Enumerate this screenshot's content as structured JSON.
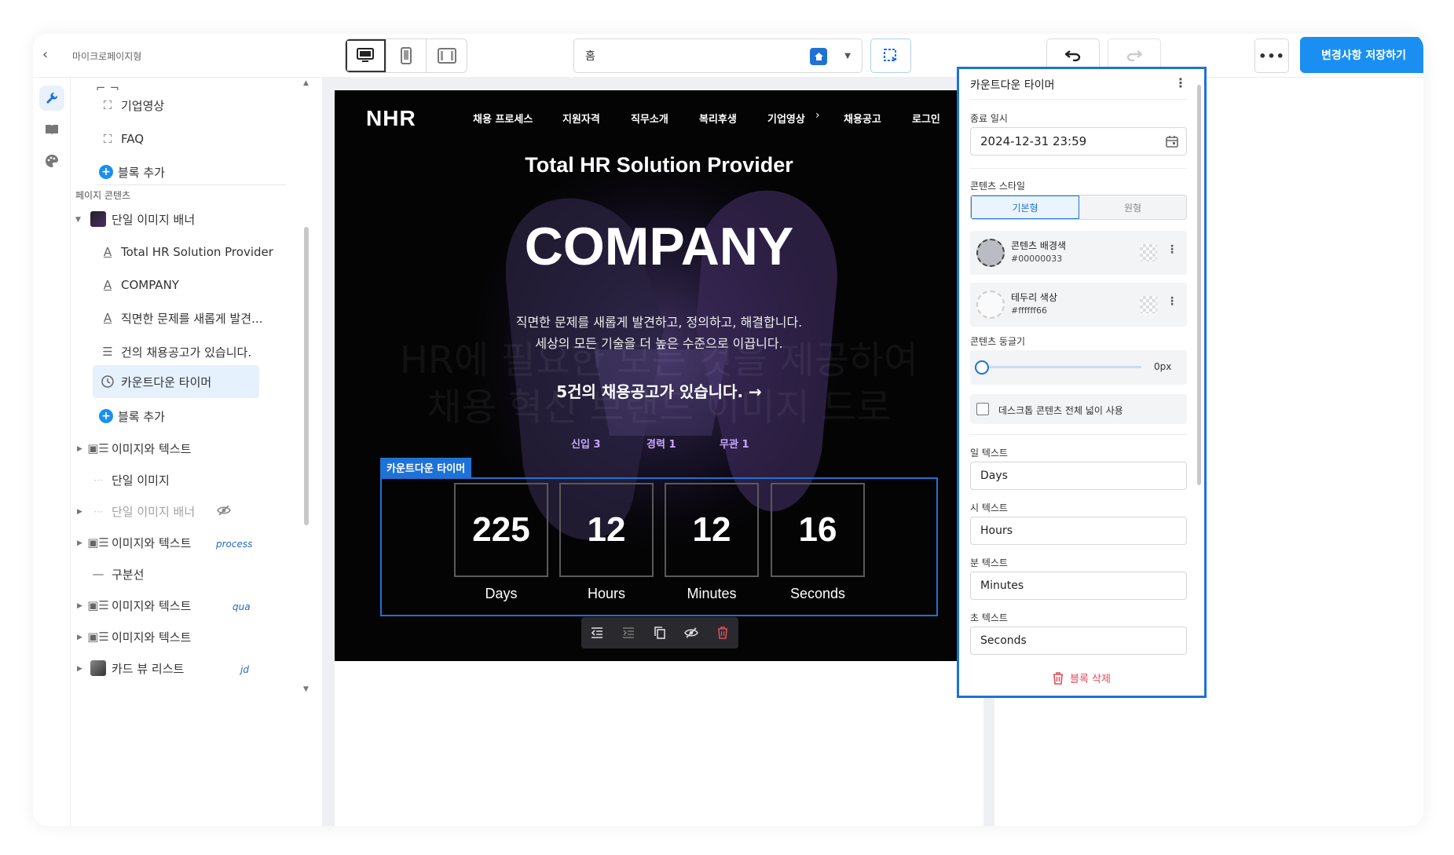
{
  "topbar": {
    "site_title": "마이크로페이지형",
    "page_select": "홈",
    "save_label": "변경사항 저장하기"
  },
  "left_panel": {
    "items_top": [
      {
        "label": "기업영상",
        "icon": "frame-icon"
      },
      {
        "label": "FAQ",
        "icon": "frame-icon"
      },
      {
        "label": "블록 추가",
        "icon": "plus-circle-icon"
      }
    ],
    "section_title": "페이지 콘텐츠",
    "banner": {
      "label": "단일 이미지 배너",
      "children": [
        {
          "label": "Total HR Solution Provider",
          "icon": "text-icon"
        },
        {
          "label": "COMPANY",
          "icon": "text-icon"
        },
        {
          "label": "직면한 문제를 새롭게 발견...",
          "icon": "text-icon"
        },
        {
          "label": "건의 채용공고가 있습니다.",
          "icon": "list-icon"
        },
        {
          "label": "카운트다운 타이머",
          "icon": "clock-icon"
        },
        {
          "label": "블록 추가",
          "icon": "plus-circle-icon"
        }
      ]
    },
    "blocks": [
      {
        "label": "이미지와 텍스트",
        "tag": ""
      },
      {
        "label": "단일 이미지",
        "tag": ""
      },
      {
        "label": "단일 이미지 배너",
        "tag": ""
      },
      {
        "label": "이미지와 텍스트",
        "tag": "process"
      },
      {
        "label": "구분선",
        "tag": ""
      },
      {
        "label": "이미지와 텍스트",
        "tag": "qua"
      },
      {
        "label": "이미지와 텍스트",
        "tag": ""
      },
      {
        "label": "카드 뷰 리스트",
        "tag": "jd"
      }
    ]
  },
  "preview": {
    "logo": "NHR",
    "nav": [
      "채용 프로세스",
      "지원자격",
      "직무소개",
      "복리후생",
      "기업영상",
      "채용공고",
      "로그인"
    ],
    "subtitle": "Total HR Solution Provider",
    "title": "COMPANY",
    "desc_line1": "직면한 문제를 새롭게 발견하고, 정의하고, 해결합니다.",
    "desc_line2": "세상의 모든 기술을 더 높은 수준으로 이끕니다.",
    "cta": "5건의 채용공고가 있습니다. →",
    "job_tags": [
      "신입 3",
      "경력 1",
      "무관 1"
    ],
    "block_tag": "카운트다운 타이머",
    "countdown": [
      {
        "value": "225",
        "label": "Days"
      },
      {
        "value": "12",
        "label": "Hours"
      },
      {
        "value": "12",
        "label": "Minutes"
      },
      {
        "value": "16",
        "label": "Seconds"
      }
    ]
  },
  "right_panel": {
    "title": "카운트다운 타이머",
    "end_date_label": "종료 일시",
    "end_date_value": "2024-12-31 23:59",
    "content_style_label": "콘텐츠 스타일",
    "style_options": [
      "기본형",
      "원형"
    ],
    "bg_color_label": "콘텐츠 배경색",
    "bg_color_value": "#00000033",
    "border_color_label": "테두리 색상",
    "border_color_value": "#ffffff66",
    "radius_label": "콘텐츠 둥글기",
    "radius_value": "0px",
    "fullwidth_label": "데스크톱 콘텐츠 전체 넓이 사용",
    "day_label": "일 텍스트",
    "day_value": "Days",
    "hour_label": "시 텍스트",
    "hour_value": "Hours",
    "minute_label": "분 텍스트",
    "minute_value": "Minutes",
    "second_label": "초 텍스트",
    "second_value": "Seconds",
    "delete_label": "블록 삭제"
  },
  "colors": {
    "accent": "#1a8ff1",
    "selection": "#1e72d6",
    "delete": "#e24b5b"
  }
}
